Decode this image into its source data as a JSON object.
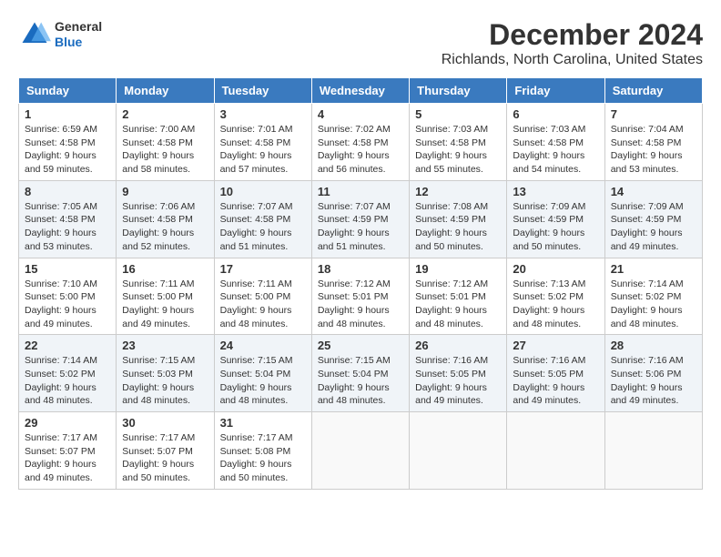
{
  "logo": {
    "general": "General",
    "blue": "Blue"
  },
  "title": "December 2024",
  "subtitle": "Richlands, North Carolina, United States",
  "days_of_week": [
    "Sunday",
    "Monday",
    "Tuesday",
    "Wednesday",
    "Thursday",
    "Friday",
    "Saturday"
  ],
  "weeks": [
    [
      {
        "day": "1",
        "sunrise": "6:59 AM",
        "sunset": "4:58 PM",
        "daylight": "9 hours and 59 minutes."
      },
      {
        "day": "2",
        "sunrise": "7:00 AM",
        "sunset": "4:58 PM",
        "daylight": "9 hours and 58 minutes."
      },
      {
        "day": "3",
        "sunrise": "7:01 AM",
        "sunset": "4:58 PM",
        "daylight": "9 hours and 57 minutes."
      },
      {
        "day": "4",
        "sunrise": "7:02 AM",
        "sunset": "4:58 PM",
        "daylight": "9 hours and 56 minutes."
      },
      {
        "day": "5",
        "sunrise": "7:03 AM",
        "sunset": "4:58 PM",
        "daylight": "9 hours and 55 minutes."
      },
      {
        "day": "6",
        "sunrise": "7:03 AM",
        "sunset": "4:58 PM",
        "daylight": "9 hours and 54 minutes."
      },
      {
        "day": "7",
        "sunrise": "7:04 AM",
        "sunset": "4:58 PM",
        "daylight": "9 hours and 53 minutes."
      }
    ],
    [
      {
        "day": "8",
        "sunrise": "7:05 AM",
        "sunset": "4:58 PM",
        "daylight": "9 hours and 53 minutes."
      },
      {
        "day": "9",
        "sunrise": "7:06 AM",
        "sunset": "4:58 PM",
        "daylight": "9 hours and 52 minutes."
      },
      {
        "day": "10",
        "sunrise": "7:07 AM",
        "sunset": "4:58 PM",
        "daylight": "9 hours and 51 minutes."
      },
      {
        "day": "11",
        "sunrise": "7:07 AM",
        "sunset": "4:59 PM",
        "daylight": "9 hours and 51 minutes."
      },
      {
        "day": "12",
        "sunrise": "7:08 AM",
        "sunset": "4:59 PM",
        "daylight": "9 hours and 50 minutes."
      },
      {
        "day": "13",
        "sunrise": "7:09 AM",
        "sunset": "4:59 PM",
        "daylight": "9 hours and 50 minutes."
      },
      {
        "day": "14",
        "sunrise": "7:09 AM",
        "sunset": "4:59 PM",
        "daylight": "9 hours and 49 minutes."
      }
    ],
    [
      {
        "day": "15",
        "sunrise": "7:10 AM",
        "sunset": "5:00 PM",
        "daylight": "9 hours and 49 minutes."
      },
      {
        "day": "16",
        "sunrise": "7:11 AM",
        "sunset": "5:00 PM",
        "daylight": "9 hours and 49 minutes."
      },
      {
        "day": "17",
        "sunrise": "7:11 AM",
        "sunset": "5:00 PM",
        "daylight": "9 hours and 48 minutes."
      },
      {
        "day": "18",
        "sunrise": "7:12 AM",
        "sunset": "5:01 PM",
        "daylight": "9 hours and 48 minutes."
      },
      {
        "day": "19",
        "sunrise": "7:12 AM",
        "sunset": "5:01 PM",
        "daylight": "9 hours and 48 minutes."
      },
      {
        "day": "20",
        "sunrise": "7:13 AM",
        "sunset": "5:02 PM",
        "daylight": "9 hours and 48 minutes."
      },
      {
        "day": "21",
        "sunrise": "7:14 AM",
        "sunset": "5:02 PM",
        "daylight": "9 hours and 48 minutes."
      }
    ],
    [
      {
        "day": "22",
        "sunrise": "7:14 AM",
        "sunset": "5:02 PM",
        "daylight": "9 hours and 48 minutes."
      },
      {
        "day": "23",
        "sunrise": "7:15 AM",
        "sunset": "5:03 PM",
        "daylight": "9 hours and 48 minutes."
      },
      {
        "day": "24",
        "sunrise": "7:15 AM",
        "sunset": "5:04 PM",
        "daylight": "9 hours and 48 minutes."
      },
      {
        "day": "25",
        "sunrise": "7:15 AM",
        "sunset": "5:04 PM",
        "daylight": "9 hours and 48 minutes."
      },
      {
        "day": "26",
        "sunrise": "7:16 AM",
        "sunset": "5:05 PM",
        "daylight": "9 hours and 49 minutes."
      },
      {
        "day": "27",
        "sunrise": "7:16 AM",
        "sunset": "5:05 PM",
        "daylight": "9 hours and 49 minutes."
      },
      {
        "day": "28",
        "sunrise": "7:16 AM",
        "sunset": "5:06 PM",
        "daylight": "9 hours and 49 minutes."
      }
    ],
    [
      {
        "day": "29",
        "sunrise": "7:17 AM",
        "sunset": "5:07 PM",
        "daylight": "9 hours and 49 minutes."
      },
      {
        "day": "30",
        "sunrise": "7:17 AM",
        "sunset": "5:07 PM",
        "daylight": "9 hours and 50 minutes."
      },
      {
        "day": "31",
        "sunrise": "7:17 AM",
        "sunset": "5:08 PM",
        "daylight": "9 hours and 50 minutes."
      },
      null,
      null,
      null,
      null
    ]
  ],
  "labels": {
    "sunrise": "Sunrise:",
    "sunset": "Sunset:",
    "daylight": "Daylight:"
  }
}
